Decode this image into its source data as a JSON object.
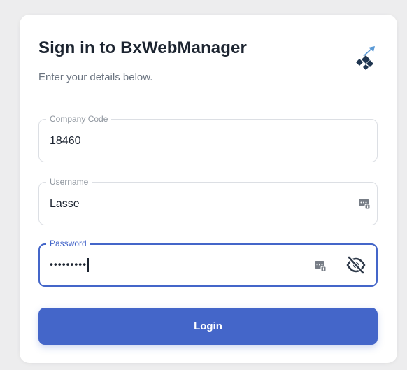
{
  "header": {
    "title": "Sign in to BxWebManager",
    "subtitle": "Enter your details below."
  },
  "logo": {
    "icon": "bx-logo-icon"
  },
  "fields": {
    "company": {
      "label": "Company Code",
      "value": "18460"
    },
    "username": {
      "label": "Username",
      "value": "Lasse",
      "icon": "password-manager-key-icon"
    },
    "password": {
      "label": "Password",
      "value": "•••••••••",
      "icons": [
        "password-manager-key-icon",
        "eye-slash-icon"
      ]
    }
  },
  "actions": {
    "login_label": "Login"
  },
  "colors": {
    "accent": "#4466c9",
    "background": "#ededee",
    "card": "#ffffff",
    "text": "#1c2430"
  }
}
